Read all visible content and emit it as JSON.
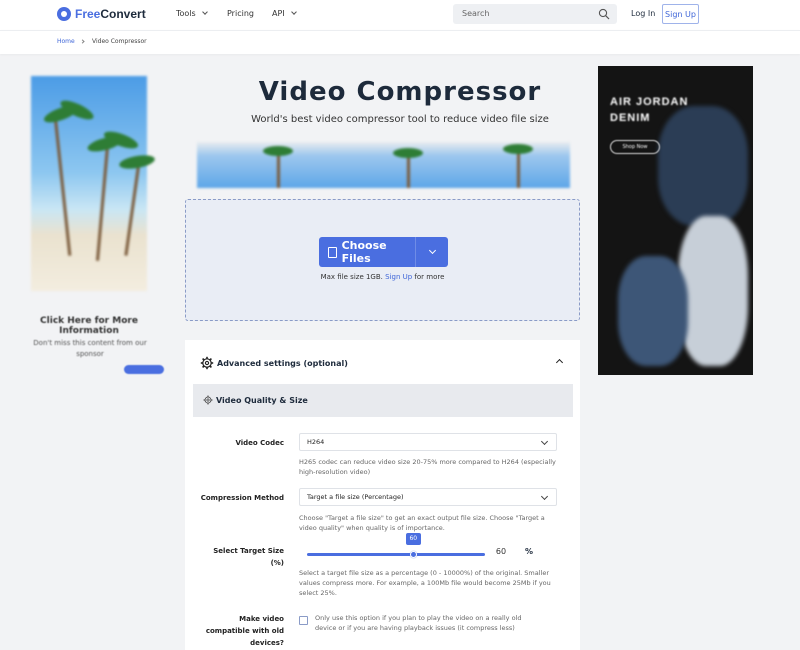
{
  "header": {
    "logo": {
      "part_a": "Free",
      "part_b": "Convert"
    },
    "nav": [
      {
        "label": "Tools",
        "has_dropdown": true
      },
      {
        "label": "Pricing",
        "has_dropdown": false
      },
      {
        "label": "API",
        "has_dropdown": true
      }
    ],
    "search_placeholder": "Search",
    "login": "Log In",
    "signup": "Sign Up"
  },
  "breadcrumb": {
    "home": "Home",
    "current": "Video Compressor"
  },
  "ads": {
    "left": {
      "title": "Click Here for More Information",
      "subtitle": "Don't miss this content from our sponsor"
    },
    "right": {
      "lines": [
        "AIR JORDAN",
        "DENIM"
      ],
      "button": "Shop Now"
    }
  },
  "main": {
    "title": "Video Compressor",
    "subtitle": "World's best video compressor tool to reduce video file size",
    "upload": {
      "button": "Choose Files",
      "max_prefix": "Max file size 1GB.",
      "max_link": "Sign Up",
      "max_suffix": "for more"
    }
  },
  "advanced": {
    "title": "Advanced settings (optional)",
    "section": "Video Quality & Size",
    "codec": {
      "label": "Video Codec",
      "value": "H264",
      "help": "H265 codec can reduce video size 20-75% more compared to H264 (especially high-resolution video)"
    },
    "method": {
      "label": "Compression Method",
      "value": "Target a file size (Percentage)",
      "help": "Choose \"Target a file size\" to get an exact output file size. Choose \"Target a video quality\" when quality is of importance."
    },
    "target": {
      "label_line1": "Select Target Size",
      "label_line2": "(%)",
      "value": 60,
      "value_text": "60",
      "unit": "%",
      "help": "Select a target file size as a percentage (0 - 10000%) of the original. Smaller values compress more. For example, a 100Mb file would become 25Mb if you select 25%."
    },
    "compat": {
      "label_line1": "Make video",
      "label_line2": "compatible with old",
      "label_line3": "devices?",
      "help": "Only use this option if you plan to play the video on a really old device or if you are having playback issues (it compress less)"
    }
  },
  "colors": {
    "accent": "#4a6ee0",
    "text": "#1e2b3c",
    "page_bg": "#f2f3f5"
  }
}
